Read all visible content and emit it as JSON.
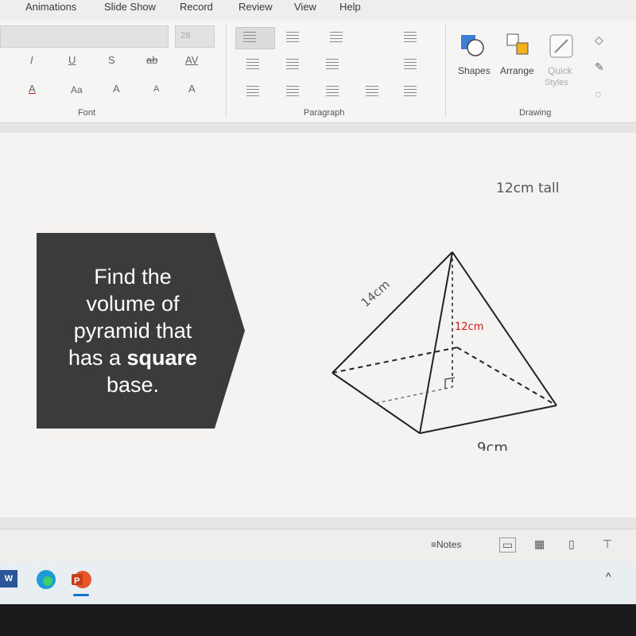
{
  "ribbon": {
    "tabs": [
      "Animations",
      "Slide Show",
      "Record",
      "Review",
      "View",
      "Help"
    ],
    "font_size_value": "28",
    "groups": {
      "font": "Font",
      "paragraph": "Paragraph",
      "drawing": "Drawing"
    },
    "buttons": {
      "shapes": "Shapes",
      "arrange": "Arrange",
      "quick_styles_1": "Quick",
      "quick_styles_2": "Styles",
      "italic": "I",
      "underline": "U",
      "strike": "S",
      "strike2": "ab",
      "spacing": "AV",
      "font_color": "A",
      "case": "Aa",
      "grow": "A",
      "shrink": "A"
    }
  },
  "slide": {
    "prompt_lines": [
      "Find the",
      "volume of",
      "pyramid that",
      "has a ",
      "square",
      "base."
    ],
    "handwritten_note": "12cm tall",
    "edge_label": "14cm",
    "height_label": "12cm",
    "base_label": "9cm",
    "callout_color": "#3b3b3b"
  },
  "statusbar": {
    "notes": "Notes"
  },
  "taskbar": {
    "apps": [
      "word-icon",
      "edge-icon",
      "powerpoint-icon"
    ]
  }
}
